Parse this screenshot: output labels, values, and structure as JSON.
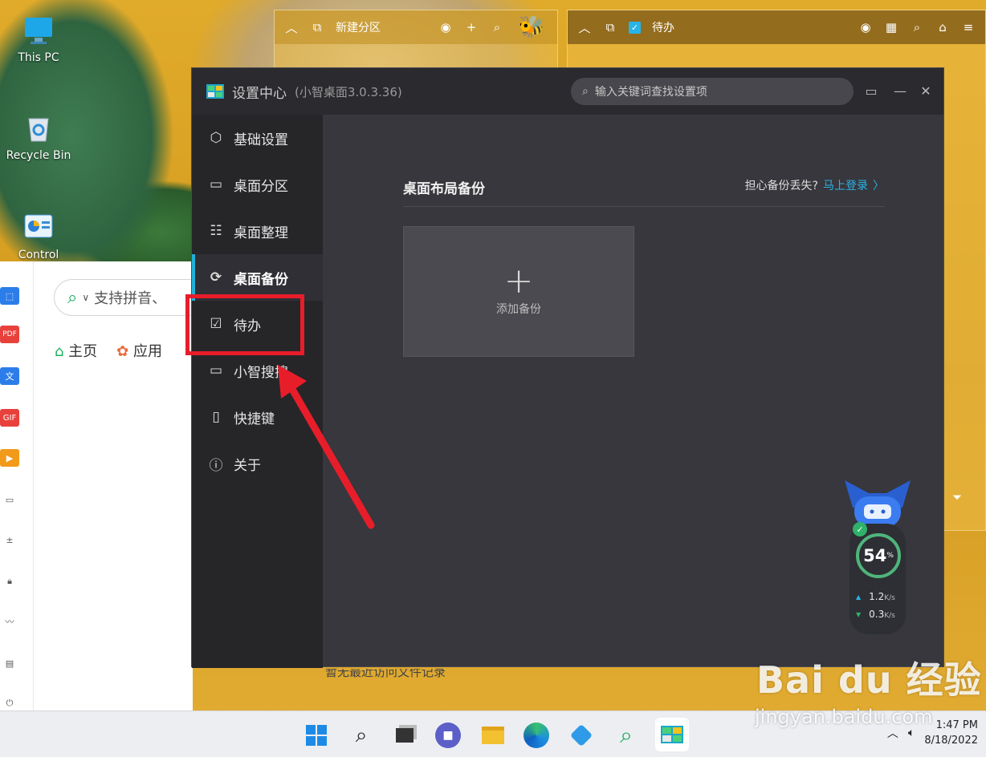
{
  "desktop": {
    "icons": [
      {
        "label": "This PC"
      },
      {
        "label": "Recycle Bin"
      },
      {
        "label": "Control"
      }
    ]
  },
  "fences": [
    {
      "title": "新建分区"
    },
    {
      "title": "待办"
    }
  ],
  "background_app": {
    "search_placeholder": "支持拼音、",
    "tabs": [
      "主页",
      "应用"
    ],
    "rail_badges": {
      "pdf": "PDF",
      "gif": "GIF",
      "text": "文"
    },
    "footer_text": "暂无最近访问文件记录"
  },
  "settings": {
    "title": "设置中心",
    "subtitle": "(小智桌面3.0.3.36)",
    "search_placeholder": "输入关键词查找设置项",
    "nav": [
      {
        "label": "基础设置",
        "icon": "hexagon-icon"
      },
      {
        "label": "桌面分区",
        "icon": "monitor-icon"
      },
      {
        "label": "桌面整理",
        "icon": "list-icon"
      },
      {
        "label": "桌面备份",
        "icon": "backup-icon",
        "active": true
      },
      {
        "label": "待办",
        "icon": "calendar-check-icon"
      },
      {
        "label": "小智搜搜",
        "icon": "window-icon"
      },
      {
        "label": "快捷键",
        "icon": "mouse-icon"
      },
      {
        "label": "关于",
        "icon": "info-icon"
      }
    ],
    "section_title": "桌面布局备份",
    "backup_hint": "担心备份丢失?",
    "login_link": "马上登录",
    "add_backup_label": "添加备份",
    "accent": "#1fb0d8"
  },
  "monitor": {
    "percent": "54",
    "percent_unit": "%",
    "up_speed": "1.2",
    "down_speed": "0.3",
    "speed_unit": "K/s"
  },
  "taskbar": {
    "time": "1:47 PM",
    "date": "8/18/2022"
  },
  "watermark": {
    "brand": "Bai du 经验",
    "url": "jingyan.baidu.com"
  },
  "annotation": {
    "highlight_color": "#e81d2a"
  }
}
